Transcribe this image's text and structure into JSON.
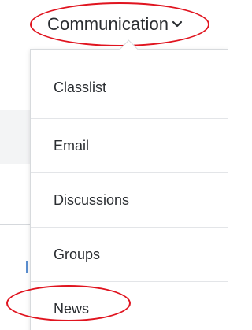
{
  "nav": {
    "label": "Communication",
    "chevron_icon": "chevron-down-icon"
  },
  "menu": {
    "items": [
      {
        "label": "Classlist"
      },
      {
        "label": "Email"
      },
      {
        "label": "Discussions"
      },
      {
        "label": "Groups"
      },
      {
        "label": "News"
      }
    ]
  },
  "colors": {
    "annotation": "#e0141f",
    "text": "#2a2d31",
    "border": "#d7dadd"
  }
}
